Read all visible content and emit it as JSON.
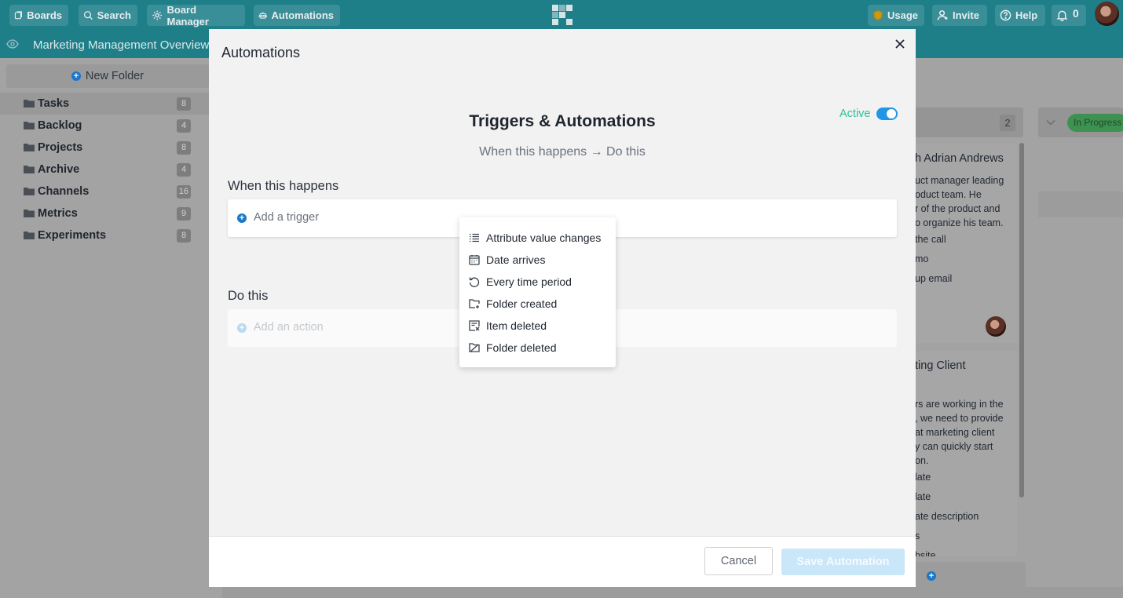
{
  "topnav": {
    "boards": "Boards",
    "search": "Search",
    "board_manager": "Board Manager",
    "automations": "Automations",
    "usage": "Usage",
    "invite": "Invite",
    "help": "Help",
    "notifications_count": "0"
  },
  "board": {
    "title": "Marketing Management Overview",
    "column_count": "2",
    "status_badge": "In Progress",
    "card1": {
      "title": "h Adrian Andrews",
      "lines": [
        "uct manager leading",
        "oduct team. He",
        "r of the product and",
        "o organize his team.",
        "the call",
        "mo",
        "up email"
      ]
    },
    "card2": {
      "title": "ting Client",
      "lines": [
        "rs are working in the",
        ", we need to provide",
        "at marketing client",
        "y can quickly start",
        "on.",
        "late",
        "late",
        "ate description",
        "s",
        "bsite"
      ]
    }
  },
  "sidebar": {
    "new_folder": "New Folder",
    "folders": [
      {
        "label": "Tasks",
        "count": "8"
      },
      {
        "label": "Backlog",
        "count": "4"
      },
      {
        "label": "Projects",
        "count": "8"
      },
      {
        "label": "Archive",
        "count": "4"
      },
      {
        "label": "Channels",
        "count": "16"
      },
      {
        "label": "Metrics",
        "count": "9"
      },
      {
        "label": "Experiments",
        "count": "8"
      }
    ]
  },
  "modal": {
    "title": "Automations",
    "heading": "Triggers & Automations",
    "active_label": "Active",
    "subheading": "When this happens → Do this",
    "when_label": "When this happens",
    "add_trigger": "Add a trigger",
    "do_label": "Do this",
    "add_action": "Add an action",
    "cancel": "Cancel",
    "save": "Save Automation"
  },
  "trigger_menu": [
    {
      "label": "Attribute value changes",
      "icon": "list-icon"
    },
    {
      "label": "Date arrives",
      "icon": "calendar-icon"
    },
    {
      "label": "Every time period",
      "icon": "repeat-icon"
    },
    {
      "label": "Folder created",
      "icon": "folder-plus-icon"
    },
    {
      "label": "Item deleted",
      "icon": "item-deleted-icon"
    },
    {
      "label": "Folder deleted",
      "icon": "folder-deleted-icon"
    }
  ],
  "colors": {
    "nav": "#1e7f89",
    "accent_blue": "#2196e6",
    "active_green": "#2dbf98"
  }
}
